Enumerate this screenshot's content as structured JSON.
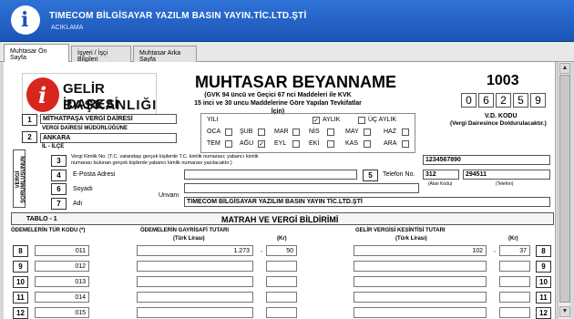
{
  "window": {
    "title": "TIMECOM BİLGİSAYAR YAZILM BASIN YAYIN.TİC.LTD.ŞTİ",
    "subtitle": "ACIKLAMA"
  },
  "tabs": [
    "Muhtasar Ön Sayfa",
    "İşyeri / İşçi Bilgileri",
    "Muhtasar Arka Sayfa"
  ],
  "logo": {
    "line1": "GELİR İDARESİ",
    "line2": "BAŞKANLIĞI"
  },
  "header": {
    "title": "MUHTASAR BEYANNAME",
    "sub1": "(GVK 94 üncü ve Geçici 67 nci Maddeleri ile KVK",
    "sub2": "15 inci ve 30 uncu Maddelerine Göre Yapılan Tevkifatlar İçin)",
    "form_no": "1003",
    "vd_code_digits": [
      "0",
      "6",
      "2",
      "5",
      "9"
    ],
    "vd_code_label": "V.D. KODU",
    "vd_code_note": "(Vergi Dairesince Doldurulacaktır.)"
  },
  "office": {
    "row1_num": "1",
    "row1_value": "MİTHATPAŞA VERGİ DAİRESİ",
    "row2_label": "VERGİ DAİRESİ MÜDÜRLÜĞÜNE",
    "row2_num": "2",
    "row2_value": "ANKARA",
    "row2_sub": "İL - İLÇE"
  },
  "period": {
    "year_label": "YILI",
    "monthly_label": "AYLIK",
    "quarterly_label": "ÜÇ AYLIK",
    "months": [
      [
        "OCA",
        "ŞUB",
        "MAR",
        "NİS",
        "MAY",
        "HAZ"
      ],
      [
        "TEM",
        "AĞU",
        "EYL",
        "EKİ",
        "KAS",
        "ARA"
      ]
    ]
  },
  "taxpayer": {
    "side_label": "VERGİ SORUMLUSUNUN",
    "row3_num": "3",
    "row3_label": "Vergi Kimlik No. (T.C. vatandaşı gerçek kişilerde T.C. kimlik numarası; yabancı kimlik",
    "row3_label2": "numarası bulunan gerçek kişilerde yabancı kimlik numarası yazılacaktır.)",
    "row3_value": "1234567890",
    "row4_num": "4",
    "row4_label": "E-Posta Adresi",
    "row5_num": "5",
    "row5_label": "Telefon No.",
    "phone_area": "312",
    "phone_number": "294511",
    "area_label": "(Alan Kodu)",
    "phone_label": "(Telefon)",
    "row6_num": "6",
    "row6_label": "Soyadı",
    "row7_num": "7",
    "row7_label": "Adı",
    "title_label": "Unvanı",
    "title_value": "TIMECOM BİLGİSAYAR YAZILIM BASIN YAYIN TİC.LTD.ŞTİ"
  },
  "table": {
    "left_label": "TABLO - 1",
    "title": "MATRAH VE VERGİ BİLDİRİMİ",
    "col_code": "ÖDEMELERİN TÜR KODU (*)",
    "col_gross": "ÖDEMELERİN GAYRİSAFİ TUTARI",
    "col_tl": "(Türk Lirası)",
    "col_kr": "(Kr)",
    "col_tax": "GELİR VERGİSİ KESİNTİSİ TUTARI",
    "rows": [
      {
        "num": "8",
        "code": "011",
        "gross_tl": "1.273",
        "gross_kr": "50",
        "tax_tl": "102",
        "tax_kr": "37",
        "right_num": "8"
      },
      {
        "num": "9",
        "code": "012",
        "gross_tl": "",
        "gross_kr": "",
        "tax_tl": "",
        "tax_kr": "",
        "right_num": "9"
      },
      {
        "num": "10",
        "code": "013",
        "gross_tl": "",
        "gross_kr": "",
        "tax_tl": "",
        "tax_kr": "",
        "right_num": "10"
      },
      {
        "num": "11",
        "code": "014",
        "gross_tl": "",
        "gross_kr": "",
        "tax_tl": "",
        "tax_kr": "",
        "right_num": "11"
      },
      {
        "num": "12",
        "code": "015",
        "gross_tl": "",
        "gross_kr": "",
        "tax_tl": "",
        "tax_kr": "",
        "right_num": "12"
      }
    ]
  }
}
